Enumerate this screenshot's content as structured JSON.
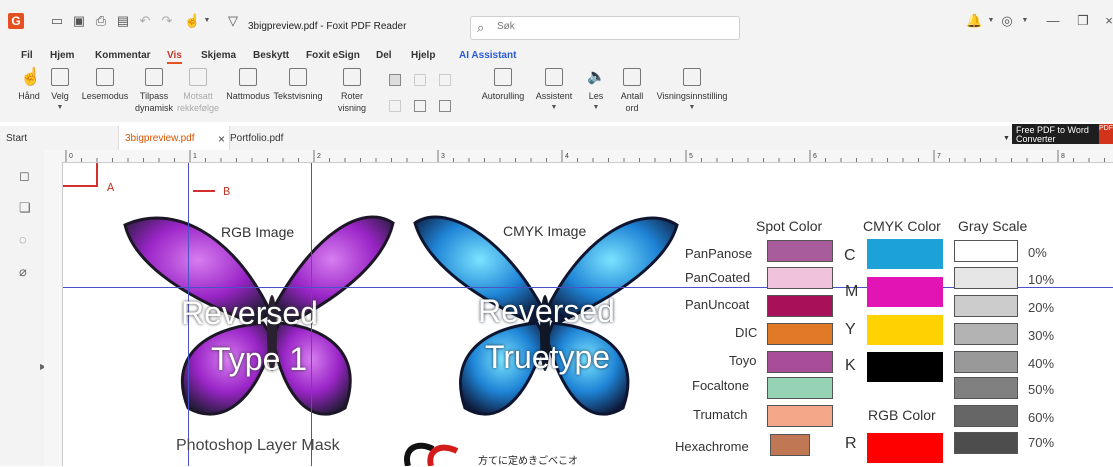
{
  "app": {
    "logo": "G",
    "doc_title": "3bigpreview.pdf - Foxit PDF Reader"
  },
  "search": {
    "placeholder": "Søk"
  },
  "menu": [
    {
      "label": "Fil"
    },
    {
      "label": "Hjem"
    },
    {
      "label": "Kommentar"
    },
    {
      "label": "Vis"
    },
    {
      "label": "Skjema"
    },
    {
      "label": "Beskytt"
    },
    {
      "label": "Foxit eSign"
    },
    {
      "label": "Del"
    },
    {
      "label": "Hjelp"
    },
    {
      "label": "AI Assistant"
    }
  ],
  "ribbon": {
    "hand": "Hånd",
    "select": "Velg",
    "reading": "Lesemodus",
    "fit_dynamic_1": "Tilpass",
    "fit_dynamic_2": "dynamisk",
    "reverse_1": "Motsatt",
    "reverse_2": "rekkefølge",
    "night": "Nattmodus",
    "text_view": "Tekstvisning",
    "rotate_1": "Roter",
    "rotate_2": "visning",
    "autoscroll": "Autorulling",
    "assistant": "Assistent",
    "read": "Les",
    "count_1": "Antall",
    "count_2": "ord",
    "view_settings": "Visningsinnstilling"
  },
  "tabs": {
    "start": "Start",
    "doc1": "3bigpreview.pdf",
    "doc2": "Portfolio.pdf",
    "close": "×"
  },
  "promo": {
    "line1": "Free PDF to Word",
    "line2": "Converter",
    "badge": "PDF"
  },
  "ruler_labels": [
    "0",
    "1",
    "2",
    "3",
    "4",
    "5",
    "6",
    "7",
    "8"
  ],
  "annotations": {
    "a": "A",
    "b": "B"
  },
  "page": {
    "rgb_image": "RGB Image",
    "cmyk_image": "CMYK Image",
    "rgb_text_1": "Reversed",
    "rgb_text_2": "Type 1",
    "cmyk_text_1": "Reversed",
    "cmyk_text_2": "Truetype",
    "photoshop": "Photoshop Layer Mask",
    "japanese": "方てに定めきごべこオ",
    "spot_color": "Spot Color",
    "cmyk_color": "CMYK Color",
    "gray_scale": "Gray Scale",
    "rgb_color": "RGB Color",
    "spot": [
      {
        "name": "PanPanose",
        "color": "#a85c9c"
      },
      {
        "name": "PanCoated",
        "color": "#f0c2dc"
      },
      {
        "name": "PanUncoat",
        "color": "#a8105a"
      },
      {
        "name": "DIC",
        "color": "#e07a27"
      },
      {
        "name": "Toyo",
        "color": "#a84d98"
      },
      {
        "name": "Focaltone",
        "color": "#96d3b4"
      },
      {
        "name": "Trumatch",
        "color": "#f5a78a"
      },
      {
        "name": "Hexachrome",
        "color": "#c07854"
      }
    ],
    "cmyk": [
      {
        "letter": "C",
        "color": "#1da2d8"
      },
      {
        "letter": "M",
        "color": "#e314b4"
      },
      {
        "letter": "Y",
        "color": "#ffd200"
      },
      {
        "letter": "K",
        "color": "#000000"
      }
    ],
    "rgb": [
      {
        "letter": "R",
        "color": "#ff0000"
      }
    ],
    "gray": [
      {
        "pct": "0%",
        "color": "#ffffff"
      },
      {
        "pct": "10%",
        "color": "#e6e6e6"
      },
      {
        "pct": "20%",
        "color": "#cccccc"
      },
      {
        "pct": "30%",
        "color": "#b3b3b3"
      },
      {
        "pct": "40%",
        "color": "#999999"
      },
      {
        "pct": "50%",
        "color": "#808080"
      },
      {
        "pct": "60%",
        "color": "#666666"
      },
      {
        "pct": "70%",
        "color": "#4d4d4d"
      }
    ]
  }
}
